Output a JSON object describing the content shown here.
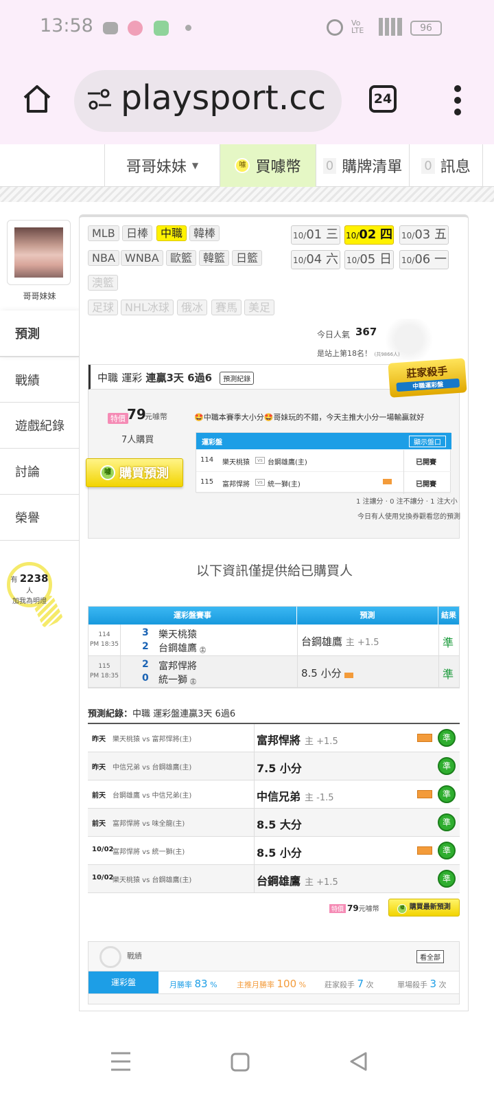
{
  "status": {
    "time": "13:58",
    "battery": "96"
  },
  "browser": {
    "url": "playsport.cc",
    "tabs_count": "24"
  },
  "topnav": {
    "user": "哥哥妹妹",
    "buy_coin": "買噱幣",
    "cart_count": "0",
    "cart_label": "購牌清單",
    "msg_count": "0",
    "msg_label": "訊息"
  },
  "sidebar": {
    "name": "哥哥妹妹",
    "tabs": [
      "預測",
      "戰績",
      "遊戲紀錄",
      "討論",
      "榮譽"
    ],
    "fans_prefix": "有",
    "fans_count": "2238",
    "fans_suffix": "人",
    "fans_text": "加我為明燈"
  },
  "leagues": {
    "row1": [
      "MLB",
      "日棒",
      "中職",
      "韓棒"
    ],
    "row2": [
      "NBA",
      "WNBA",
      "歐籃",
      "韓籃",
      "日籃"
    ],
    "row3": [
      "澳籃"
    ],
    "row4": [
      "足球",
      "NHL冰球",
      "俄冰",
      "賽馬",
      "美足"
    ]
  },
  "dates": [
    {
      "m": "10/",
      "d": "01",
      "w": "三"
    },
    {
      "m": "10/",
      "d": "02",
      "w": "四"
    },
    {
      "m": "10/",
      "d": "03",
      "w": "五"
    },
    {
      "m": "10/",
      "d": "04",
      "w": "六"
    },
    {
      "m": "10/",
      "d": "05",
      "w": "日"
    },
    {
      "m": "10/",
      "d": "06",
      "w": "一"
    }
  ],
  "popularity": {
    "label": "今日人氣",
    "value": "367",
    "rank": "是站上第18名！",
    "rank_sub": "(共9866人)"
  },
  "card": {
    "league": "中職",
    "market": "運彩",
    "streak": "連贏3天 6過6",
    "records_btn": "預測紀錄",
    "badge_main": "莊家殺手",
    "badge_sub": "中職運彩盤",
    "price_tag": "特價",
    "price": "79",
    "price_unit": "元噱幣",
    "buyers": "7人購買",
    "buy_btn": "購買預測",
    "comment": "🤩中職本賽季大小分🤩哥妹玩的不錯，今天主推大小分一場輸贏就好",
    "mini_head": "運彩盤",
    "mini_show": "顯示盤口",
    "games": [
      {
        "code": "114",
        "away": "樂天桃猿",
        "home": "台鋼雄鷹(主)",
        "state": "已開賽"
      },
      {
        "code": "115",
        "away": "富邦悍將",
        "home": "統一獅(主)",
        "state": "已開賽"
      }
    ],
    "note1": "1 注讓分 · 0 注不讓分 · 1 注大小",
    "note2": "今日有人使用兌換券觀看您的預測"
  },
  "purchase_only": "以下資訊僅提供給已購買人",
  "results": {
    "headers": [
      "運彩盤賽事",
      "預測",
      "結果"
    ],
    "rows": [
      {
        "code": "114",
        "time": "PM 18:35",
        "s1": "3",
        "t1": "樂天桃猿",
        "s2": "2",
        "t2": "台鋼雄鷹",
        "pick": "台鋼雄鷹",
        "pick_dim": "主 +1.5",
        "result": "準"
      },
      {
        "code": "115",
        "time": "PM 18:35",
        "s1": "2",
        "t1": "富邦悍將",
        "s2": "0",
        "t2": "統一獅",
        "pick": "8.5 小分",
        "pick_dim": "",
        "result": "準"
      }
    ]
  },
  "history": {
    "title": "預測紀錄：",
    "title_sub": "中職 運彩盤連贏3天 6過6",
    "rows": [
      {
        "day": "昨天",
        "match": "樂天桃猿 vs 富邦悍將(主)",
        "pick": "富邦悍將",
        "dim": "主 +1.5",
        "zhu": true,
        "res": "準"
      },
      {
        "day": "昨天",
        "match": "中信兄弟 vs 台鋼雄鷹(主)",
        "pick": "7.5 小分",
        "dim": "",
        "zhu": false,
        "res": "準"
      },
      {
        "day": "前天",
        "match": "台鋼雄鷹 vs 中信兄弟(主)",
        "pick": "中信兄弟",
        "dim": "主 -1.5",
        "zhu": true,
        "res": "準"
      },
      {
        "day": "前天",
        "match": "富邦悍將 vs 味全龍(主)",
        "pick": "8.5 大分",
        "dim": "",
        "zhu": false,
        "res": "準"
      },
      {
        "day": "10/02",
        "match": "富邦悍將 vs 統一獅(主)",
        "pick": "8.5 小分",
        "dim": "",
        "zhu": true,
        "res": "準"
      },
      {
        "day": "10/02",
        "match": "樂天桃猿 vs 台鋼雄鷹(主)",
        "pick": "台鋼雄鷹",
        "dim": "主 +1.5",
        "zhu": false,
        "res": "準"
      }
    ]
  },
  "bottom_buy": {
    "tag": "特價",
    "price": "79",
    "unit": "元噱幣",
    "btn": "購買最新預測"
  },
  "stats": {
    "title": "戰績",
    "all_btn": "看全部",
    "category": "運彩盤",
    "items": [
      {
        "label": "月勝率",
        "value": "83",
        "unit": "%",
        "color": "#1d9ee6"
      },
      {
        "label": "主推月勝率",
        "value": "100",
        "unit": "%",
        "color": "#f39b3a"
      },
      {
        "label": "莊家殺手",
        "value": "7",
        "unit": "次",
        "color": "#1d9ee6"
      },
      {
        "label": "單場殺手",
        "value": "3",
        "unit": "次",
        "color": "#1d9ee6"
      }
    ]
  }
}
